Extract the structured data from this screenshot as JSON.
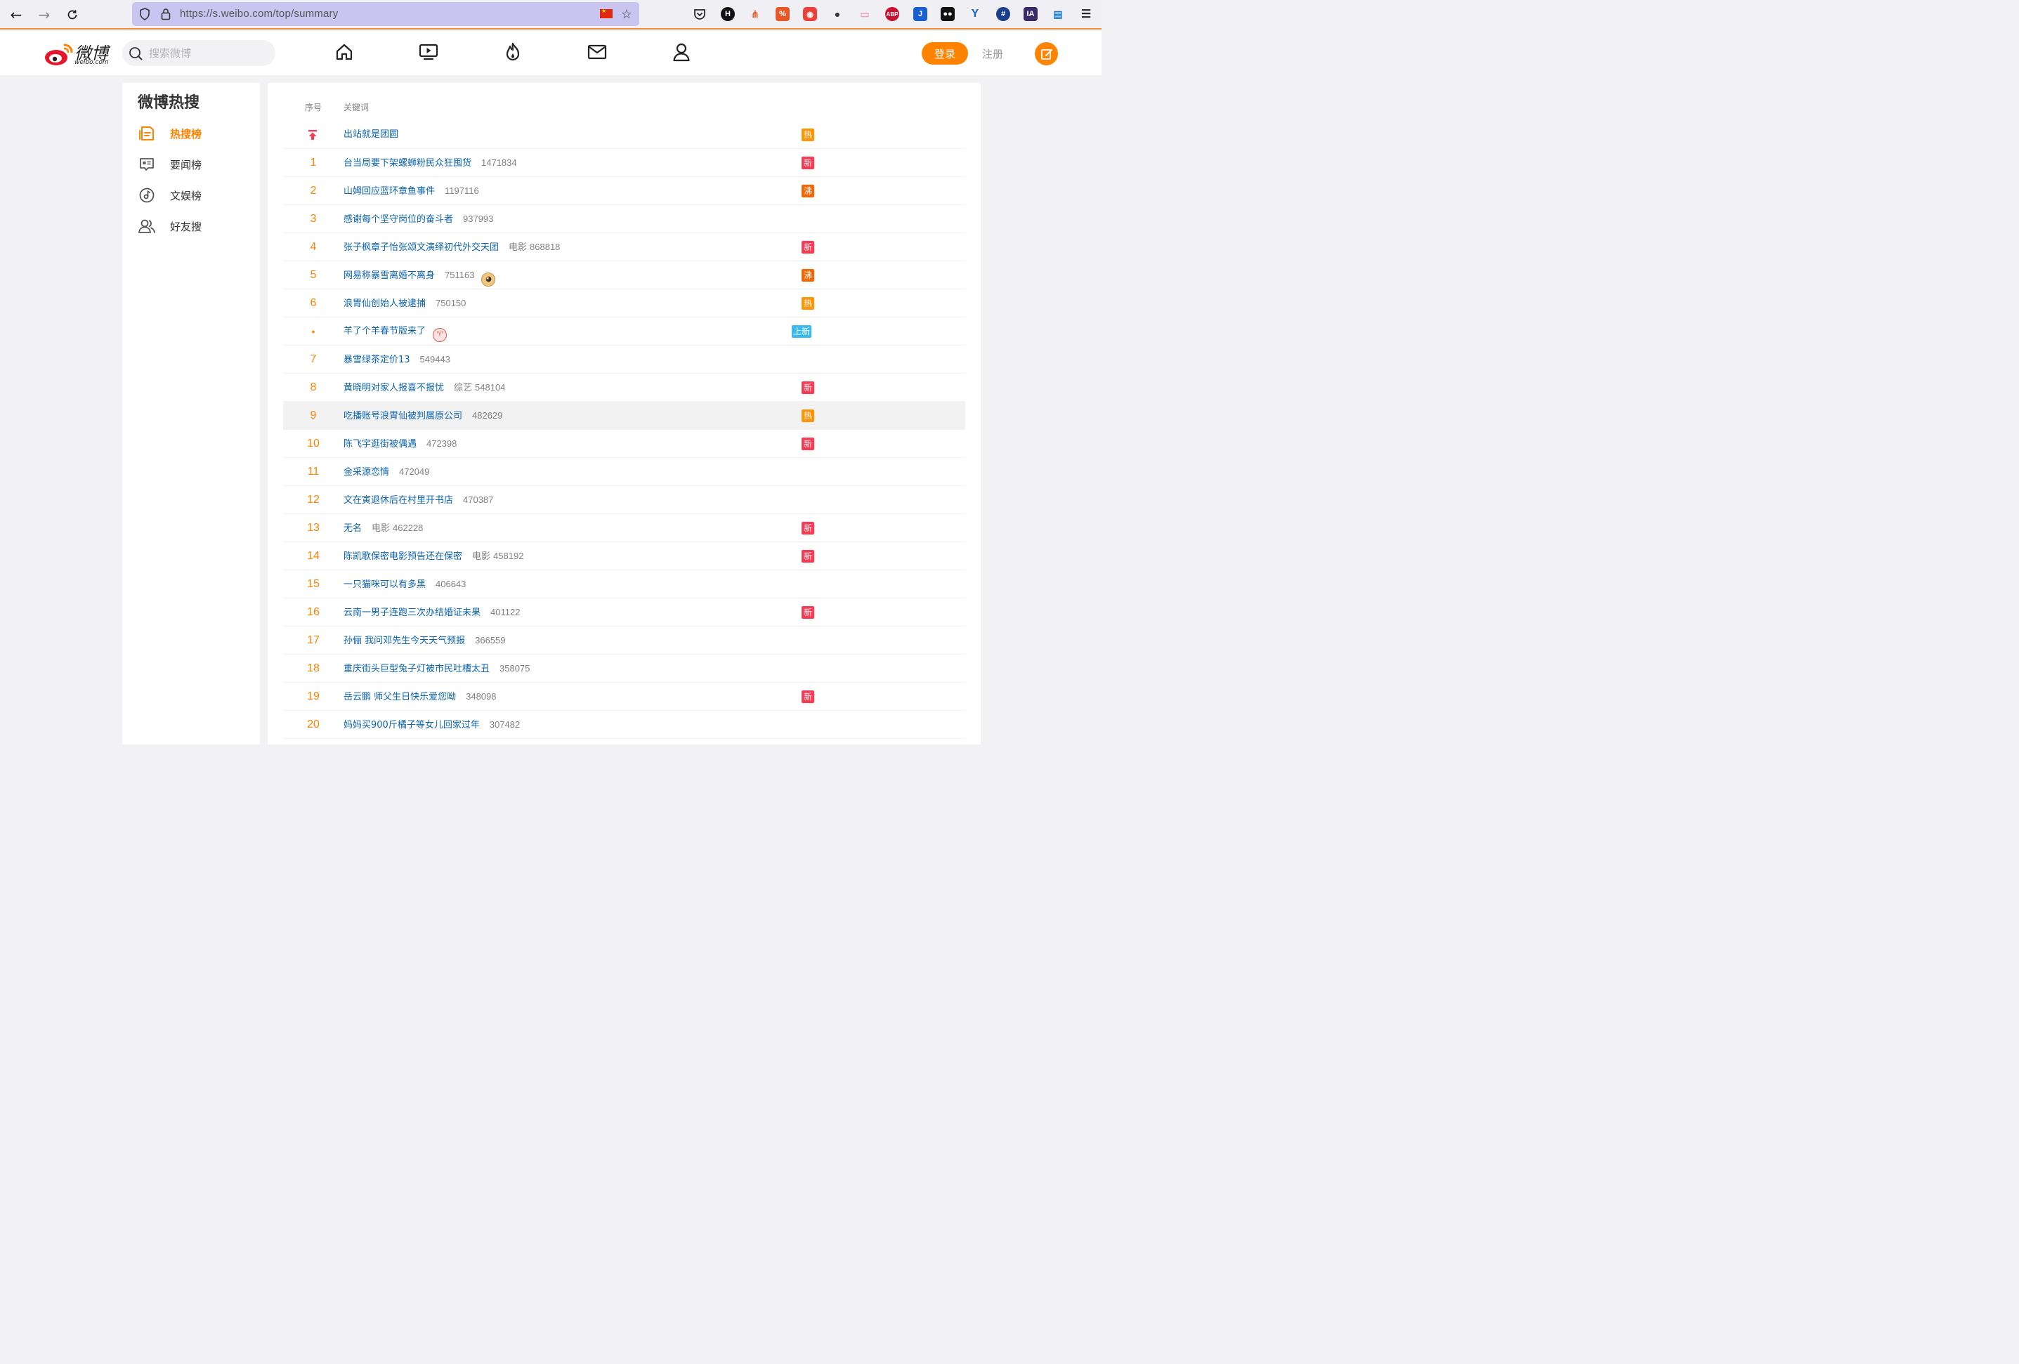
{
  "browser": {
    "url": "https://s.weibo.com/top/summary",
    "extensions": [
      "pocket-icon",
      "h-icon",
      "tree-icon",
      "percent-icon",
      "camera-icon",
      "dots-icon",
      "tv-icon",
      "adblock-icon",
      "j-icon",
      "glasses-icon",
      "v-icon",
      "hash-icon",
      "ia-icon",
      "doc-icon",
      "menu-icon"
    ],
    "ext_labels": {
      "h": "H",
      "percent": "%",
      "abp": "ABP",
      "j": "J",
      "hash": "#",
      "ia": "IA"
    }
  },
  "header": {
    "logo_text": "微博",
    "logo_domain": "weibo.com",
    "search_placeholder": "搜索微博",
    "nav": [
      "home-icon",
      "video-icon",
      "hot-icon",
      "message-icon",
      "profile-icon"
    ],
    "login_label": "登录",
    "register_label": "注册",
    "accent_color": "#ff8200"
  },
  "sidebar": {
    "title": "微博热搜",
    "items": [
      {
        "label": "热搜榜",
        "icon": "hot-list-icon",
        "active": true
      },
      {
        "label": "要闻榜",
        "icon": "news-icon",
        "active": false
      },
      {
        "label": "文娱榜",
        "icon": "entertainment-icon",
        "active": false
      },
      {
        "label": "好友搜",
        "icon": "friends-icon",
        "active": false
      }
    ]
  },
  "list": {
    "col_rank": "序号",
    "col_keyword": "关键词",
    "rows": [
      {
        "rank": "",
        "rank_type": "pin",
        "keyword": "出站就是团圆",
        "category": "",
        "count": "",
        "tag": "热",
        "tag_color": "#ff9406"
      },
      {
        "rank": "1",
        "keyword": "台当局要下架螺蛳粉民众狂囤货",
        "category": "",
        "count": "1471834",
        "tag": "新",
        "tag_color": "#ff3852"
      },
      {
        "rank": "2",
        "keyword": "山姆回应蓝环章鱼事件",
        "category": "",
        "count": "1197116",
        "tag": "沸",
        "tag_color": "#f86400"
      },
      {
        "rank": "3",
        "keyword": "感谢每个坚守岗位的奋斗者",
        "category": "",
        "count": "937993",
        "tag": "",
        "tag_color": ""
      },
      {
        "rank": "4",
        "keyword": "张子枫章子怡张颂文演绎初代外交天团",
        "category": "电影",
        "count": "868818",
        "tag": "新",
        "tag_color": "#ff3852"
      },
      {
        "rank": "5",
        "keyword": "网易称暴雪离婚不离身",
        "category": "",
        "count": "751163",
        "emoji": "doge",
        "tag": "沸",
        "tag_color": "#f86400"
      },
      {
        "rank": "6",
        "keyword": "浪胃仙创始人被逮捕",
        "category": "",
        "count": "750150",
        "tag": "热",
        "tag_color": "#ff9406"
      },
      {
        "rank": "•",
        "rank_type": "dot",
        "keyword": "羊了个羊春节版来了",
        "category": "",
        "count": "",
        "emoji": "sheep",
        "tag": "上新",
        "tag_color": "#3bbaf2"
      },
      {
        "rank": "7",
        "keyword": "暴雪绿茶定价13",
        "category": "",
        "count": "549443",
        "tag": "",
        "tag_color": ""
      },
      {
        "rank": "8",
        "keyword": "黄晓明对家人报喜不报忧",
        "category": "综艺",
        "count": "548104",
        "tag": "新",
        "tag_color": "#ff3852"
      },
      {
        "rank": "9",
        "keyword": "吃播账号浪胃仙被判属原公司",
        "category": "",
        "count": "482629",
        "tag": "热",
        "tag_color": "#ff9406",
        "hover": true
      },
      {
        "rank": "10",
        "keyword": "陈飞宇逛街被偶遇",
        "category": "",
        "count": "472398",
        "tag": "新",
        "tag_color": "#ff3852"
      },
      {
        "rank": "11",
        "keyword": "金采源恋情",
        "category": "",
        "count": "472049",
        "tag": "",
        "tag_color": ""
      },
      {
        "rank": "12",
        "keyword": "文在寅退休后在村里开书店",
        "category": "",
        "count": "470387",
        "tag": "",
        "tag_color": ""
      },
      {
        "rank": "13",
        "keyword": "无名",
        "category": "电影",
        "count": "462228",
        "tag": "新",
        "tag_color": "#ff3852"
      },
      {
        "rank": "14",
        "keyword": "陈凯歌保密电影预告还在保密",
        "category": "电影",
        "count": "458192",
        "tag": "新",
        "tag_color": "#ff3852"
      },
      {
        "rank": "15",
        "keyword": "一只猫咪可以有多黑",
        "category": "",
        "count": "406643",
        "tag": "",
        "tag_color": ""
      },
      {
        "rank": "16",
        "keyword": "云南一男子连跑三次办结婚证未果",
        "category": "",
        "count": "401122",
        "tag": "新",
        "tag_color": "#ff3852"
      },
      {
        "rank": "17",
        "keyword": "孙俪 我问邓先生今天天气预报",
        "category": "",
        "count": "366559",
        "tag": "",
        "tag_color": ""
      },
      {
        "rank": "18",
        "keyword": "重庆街头巨型兔子灯被市民吐槽太丑",
        "category": "",
        "count": "358075",
        "tag": "",
        "tag_color": ""
      },
      {
        "rank": "19",
        "keyword": "岳云鹏 师父生日快乐爱您呦",
        "category": "",
        "count": "348098",
        "tag": "新",
        "tag_color": "#ff3852"
      },
      {
        "rank": "20",
        "keyword": "妈妈买900斤橘子等女儿回家过年",
        "category": "",
        "count": "307482",
        "tag": "",
        "tag_color": ""
      }
    ]
  }
}
